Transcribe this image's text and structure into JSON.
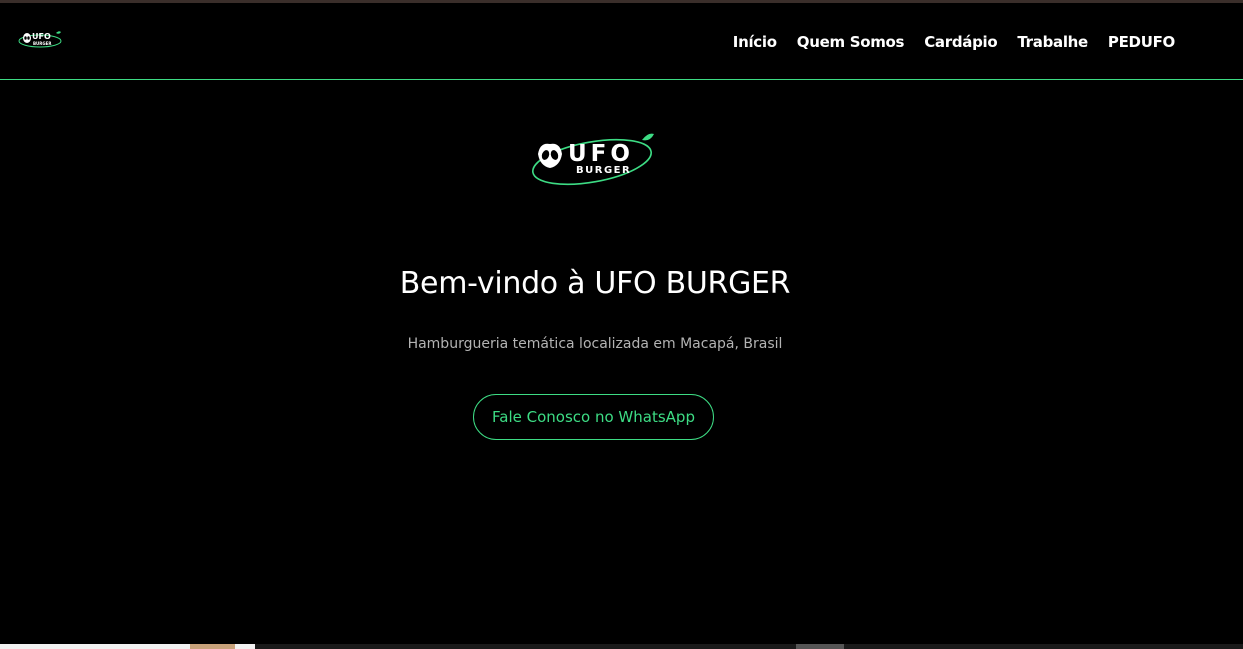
{
  "nav": {
    "items": [
      {
        "label": "Início"
      },
      {
        "label": "Quem Somos"
      },
      {
        "label": "Cardápio"
      },
      {
        "label": "Trabalhe"
      },
      {
        "label": "PEDUFO"
      }
    ]
  },
  "logo": {
    "line1": "UFO",
    "line2": "BURGER"
  },
  "hero": {
    "title": "Bem-vindo à UFO BURGER",
    "subtitle": "Hamburgueria temática localizada em Macapá, Brasil",
    "cta_label": "Fale Conosco no WhatsApp"
  },
  "colors": {
    "accent": "#3ddc84",
    "background": "#000000"
  }
}
